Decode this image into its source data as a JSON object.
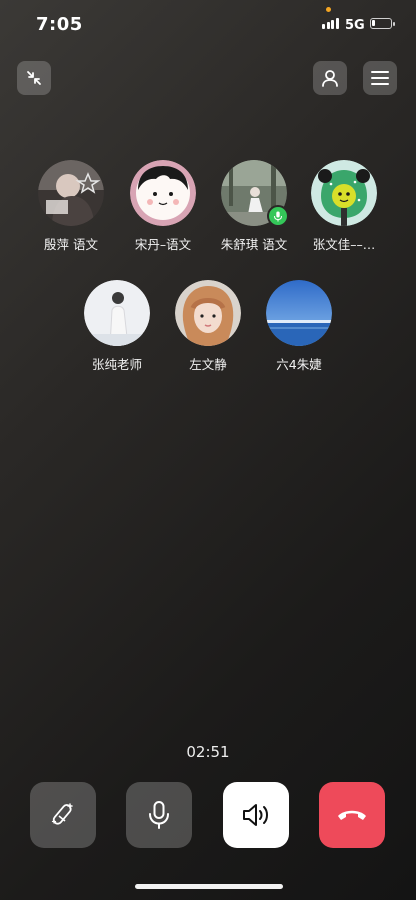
{
  "status_bar": {
    "time": "7:05",
    "network": "5G",
    "battery_level": 0.15
  },
  "participants": [
    {
      "name": "殷萍 语文",
      "avatar": "photo-avatar",
      "speaking": false
    },
    {
      "name": "宋丹–语文",
      "avatar": "cartoon-girl-avatar",
      "speaking": false
    },
    {
      "name": "朱舒琪 语文",
      "avatar": "photo-avatar",
      "speaking": true
    },
    {
      "name": "张文佳––…",
      "avatar": "cartoon-panda-avatar",
      "speaking": false
    },
    {
      "name": "张纯老师",
      "avatar": "photo-avatar",
      "speaking": false
    },
    {
      "name": "左文静",
      "avatar": "photo-avatar",
      "speaking": false
    },
    {
      "name": "六4朱婕",
      "avatar": "sky-sea-avatar",
      "speaking": false
    }
  ],
  "call": {
    "duration": "02:51"
  },
  "controls": {
    "effects_icon": "magic-wand-icon",
    "mic_icon": "microphone-icon",
    "speaker_icon": "speaker-icon",
    "hangup_icon": "hang-up-icon",
    "hangup_color": "#ee4a5a"
  },
  "colors": {
    "speaking_badge": "#34c759"
  }
}
